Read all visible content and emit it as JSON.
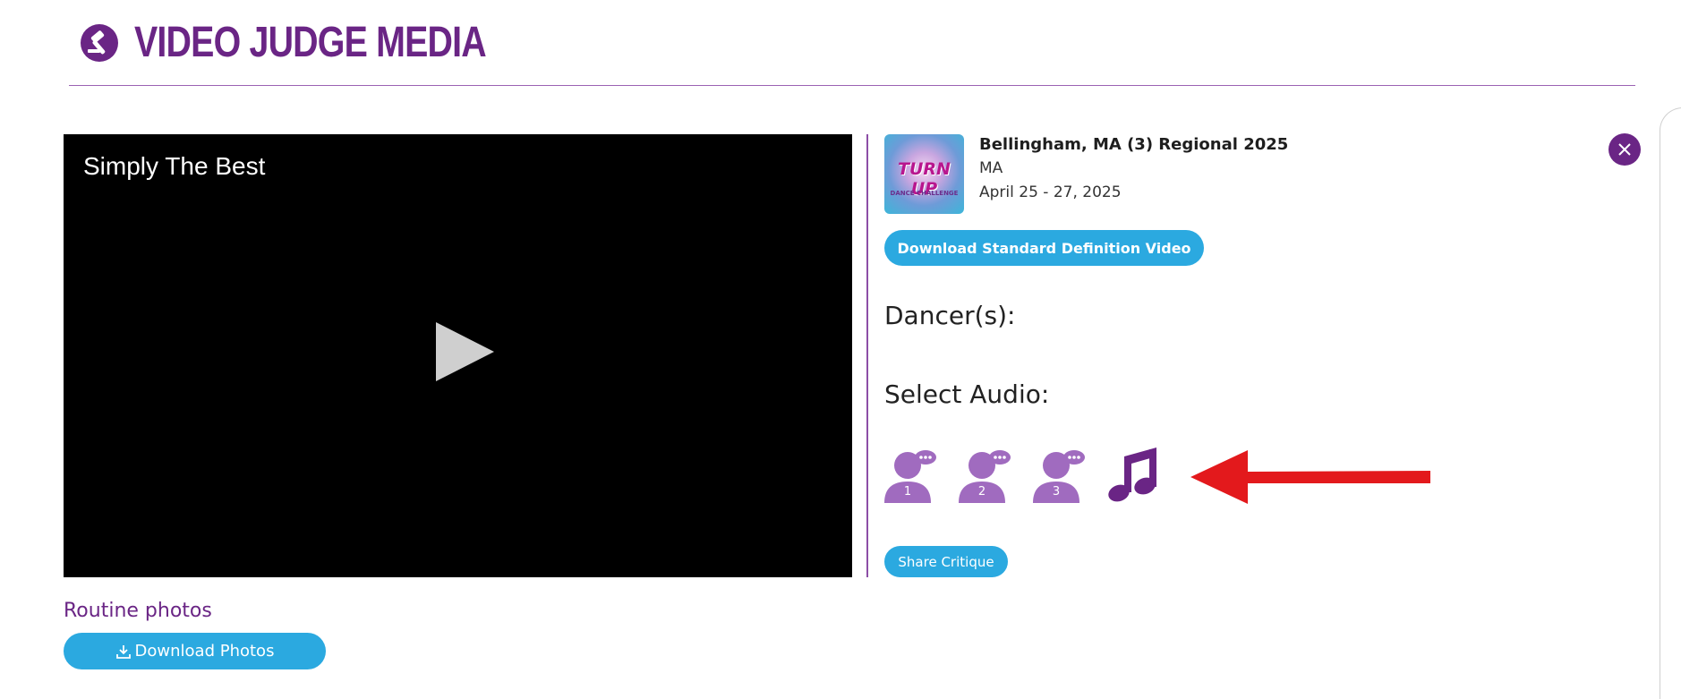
{
  "header": {
    "brand_title": "VIDEO JUDGE MEDIA",
    "logo_icon": "gavel-icon",
    "brand_color": "#6a2585"
  },
  "video": {
    "title": "Simply The Best",
    "play_icon": "play-icon"
  },
  "event": {
    "name": "Bellingham, MA (3) Regional 2025",
    "state": "MA",
    "dates": "April 25 - 27, 2025",
    "thumbnail_text": "TURN UP",
    "thumbnail_subtext": "DANCE CHALLENGE"
  },
  "actions": {
    "download_sd_label": "Download Standard Definition Video",
    "share_label": "Share Critique",
    "accent_color": "#2ba9e0"
  },
  "dancers": {
    "label": "Dancer(s):"
  },
  "audio": {
    "label": "Select Audio:",
    "options": [
      {
        "number": "1",
        "icon": "judge-1-icon"
      },
      {
        "number": "2",
        "icon": "judge-2-icon"
      },
      {
        "number": "3",
        "icon": "judge-3-icon"
      },
      {
        "icon": "music-note-icon"
      }
    ],
    "annotation": "red-arrow-icon"
  },
  "photos": {
    "label": "Routine photos",
    "download_label": "Download Photos"
  },
  "close_icon": "close-icon"
}
